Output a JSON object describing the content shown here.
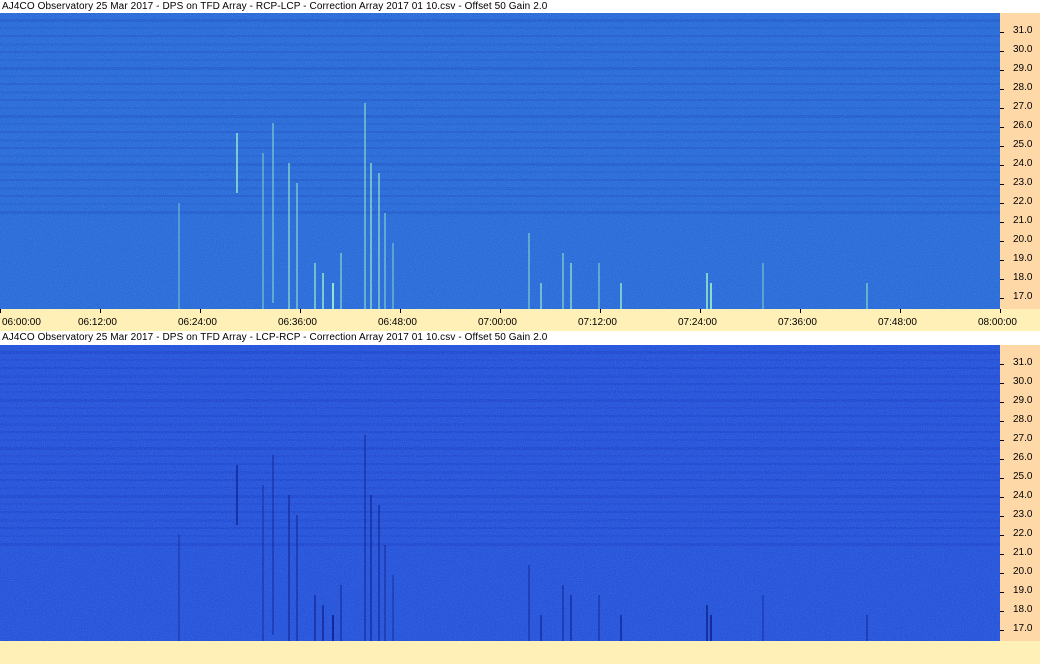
{
  "top_panel": {
    "title": "AJ4CO Observatory 25 Mar 2017  -  DPS on TFD Array  -  RCP-LCP  -  Correction Array 2017 01 10.csv  -  Offset 50  Gain 2.0",
    "colors": {
      "base": "#2a6ad6",
      "burst_bright": "#9ef0c8",
      "band": "#1d4fc0"
    }
  },
  "bottom_panel": {
    "title": "AJ4CO Observatory 25 Mar 2017  -  DPS on TFD Array  -  LCP-RCP  -  Correction Array 2017 01 10.csv  -  Offset 50  Gain 2.0",
    "colors": {
      "base": "#2752d8",
      "burst_dark": "#0e1e8a",
      "band": "#1c3cc0"
    }
  },
  "y_axis_labels": [
    "31.0",
    "30.0",
    "29.0",
    "28.0",
    "27.0",
    "26.0",
    "25.0",
    "24.0",
    "23.0",
    "22.0",
    "21.0",
    "20.0",
    "19.0",
    "18.0",
    "17.0"
  ],
  "x_axis_labels": [
    "06:00:00",
    "06:12:00",
    "06:24:00",
    "06:36:00",
    "06:48:00",
    "07:00:00",
    "07:12:00",
    "07:24:00",
    "07:36:00",
    "07:48:00",
    "08:00:00"
  ],
  "colors": {
    "axis_bg": "#ffd8a8",
    "time_strip_bg": "#fff0b8"
  }
}
